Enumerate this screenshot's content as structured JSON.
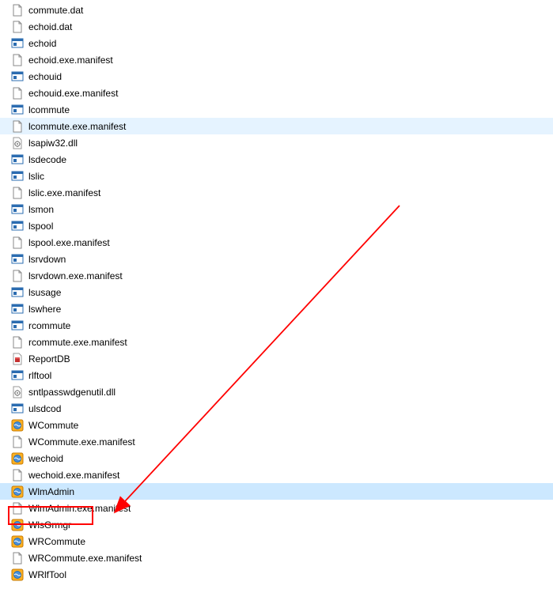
{
  "files": [
    {
      "name": "commute.dat",
      "icon": "file"
    },
    {
      "name": "echoid.dat",
      "icon": "file"
    },
    {
      "name": "echoid",
      "icon": "exe"
    },
    {
      "name": "echoid.exe.manifest",
      "icon": "file"
    },
    {
      "name": "echouid",
      "icon": "exe"
    },
    {
      "name": "echouid.exe.manifest",
      "icon": "file"
    },
    {
      "name": "lcommute",
      "icon": "exe"
    },
    {
      "name": "lcommute.exe.manifest",
      "icon": "file",
      "state": "hover"
    },
    {
      "name": "lsapiw32.dll",
      "icon": "dll"
    },
    {
      "name": "lsdecode",
      "icon": "exe"
    },
    {
      "name": "lslic",
      "icon": "exe"
    },
    {
      "name": "lslic.exe.manifest",
      "icon": "file"
    },
    {
      "name": "lsmon",
      "icon": "exe"
    },
    {
      "name": "lspool",
      "icon": "exe"
    },
    {
      "name": "lspool.exe.manifest",
      "icon": "file"
    },
    {
      "name": "lsrvdown",
      "icon": "exe"
    },
    {
      "name": "lsrvdown.exe.manifest",
      "icon": "file"
    },
    {
      "name": "lsusage",
      "icon": "exe"
    },
    {
      "name": "lswhere",
      "icon": "exe"
    },
    {
      "name": "rcommute",
      "icon": "exe"
    },
    {
      "name": "rcommute.exe.manifest",
      "icon": "file"
    },
    {
      "name": "ReportDB",
      "icon": "db"
    },
    {
      "name": "rlftool",
      "icon": "exe"
    },
    {
      "name": "sntlpasswdgenutil.dll",
      "icon": "dll"
    },
    {
      "name": "ulsdcod",
      "icon": "exe"
    },
    {
      "name": "WCommute",
      "icon": "app"
    },
    {
      "name": "WCommute.exe.manifest",
      "icon": "file"
    },
    {
      "name": "wechoid",
      "icon": "app"
    },
    {
      "name": "wechoid.exe.manifest",
      "icon": "file"
    },
    {
      "name": "WlmAdmin",
      "icon": "app",
      "state": "selected"
    },
    {
      "name": "WlmAdmin.exe.manifest",
      "icon": "file"
    },
    {
      "name": "WlsGrmgr",
      "icon": "app"
    },
    {
      "name": "WRCommute",
      "icon": "app"
    },
    {
      "name": "WRCommute.exe.manifest",
      "icon": "file"
    },
    {
      "name": "WRlfTool",
      "icon": "app"
    }
  ],
  "annotation": {
    "arrow_color": "#ff0000",
    "box_color": "#ff0000"
  }
}
